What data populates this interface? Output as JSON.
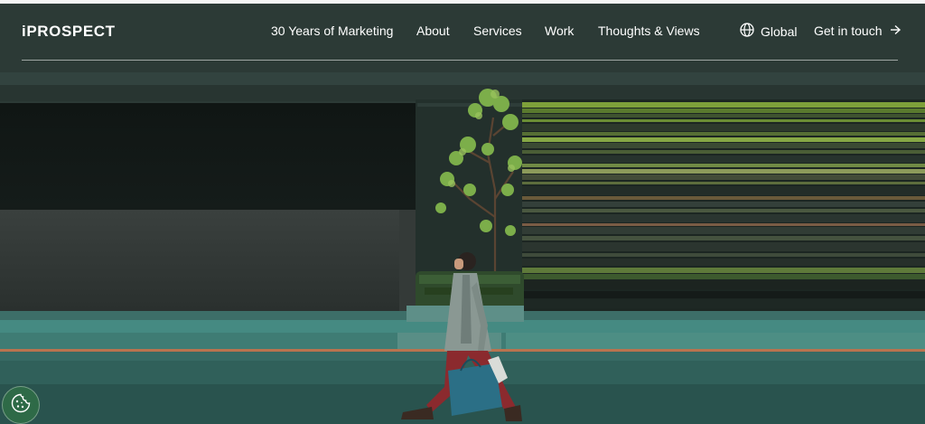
{
  "brand": {
    "logo_text": "iPROSPECT"
  },
  "nav": {
    "items": [
      {
        "label": "30 Years of Marketing"
      },
      {
        "label": "About"
      },
      {
        "label": "Services"
      },
      {
        "label": "Work"
      },
      {
        "label": "Thoughts & Views"
      }
    ],
    "global_label": "Global",
    "cta_label": "Get in touch"
  },
  "icons": {
    "global": "globe-icon",
    "cta": "arrow-right-icon",
    "cookie": "cookie-icon"
  },
  "colors": {
    "text": "#ffffff",
    "cookie_button": "#2e6a47"
  }
}
